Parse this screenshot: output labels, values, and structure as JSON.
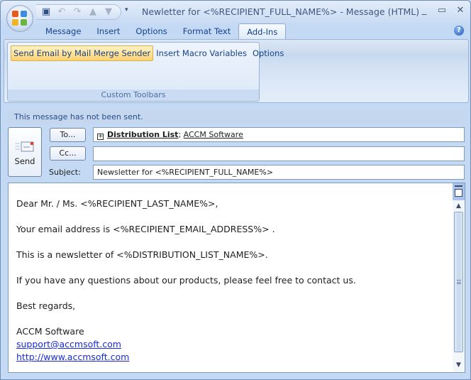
{
  "window": {
    "title": "Newletter for <%RECIPIENT_FULL_NAME%> - Message (HTML)",
    "controls": {
      "minimize": "_",
      "maximize": "▭",
      "close": "✕"
    }
  },
  "quick_access": {
    "icons": [
      "save-icon",
      "undo-icon",
      "redo-icon",
      "previous-item-icon",
      "next-item-icon"
    ],
    "customize_glyph": "▾"
  },
  "tabs": [
    {
      "label": "Message",
      "active": false
    },
    {
      "label": "Insert",
      "active": false
    },
    {
      "label": "Options",
      "active": false
    },
    {
      "label": "Format Text",
      "active": false
    },
    {
      "label": "Add-Ins",
      "active": true
    }
  ],
  "help_glyph": "?",
  "ribbon": {
    "group_label": "Custom Toolbars",
    "buttons": [
      {
        "label": "Send Email by Mail Merge Sender",
        "highlighted": true
      },
      {
        "label": "Insert Macro Variables",
        "highlighted": false
      },
      {
        "label": "Options",
        "highlighted": false
      }
    ]
  },
  "info_bar": "This message has not been sent.",
  "header": {
    "send_label": "Send",
    "to_button": "To...",
    "cc_button": "Cc...",
    "subject_label": "Subject:",
    "to_value": {
      "expand_glyph": "+",
      "distribution_list": "Distribution List",
      "separator": ";",
      "recipient": "ACCM Software"
    },
    "cc_value": "",
    "subject_value": "Newsletter for <%RECIPIENT_FULL_NAME%>"
  },
  "body": {
    "greeting": "Dear Mr. / Ms. <%RECIPIENT_LAST_NAME%>,",
    "line_email": "Your email address is <%RECIPIENT_EMAIL_ADDRESS%> .",
    "line_newsletter": "This is a newsletter of <%DISTRIBUTION_LIST_NAME%>.",
    "line_questions": "If you have any questions about our products, please feel free to contact us.",
    "closing": "Best regards,",
    "signature_name": "ACCM Software",
    "signature_email": "support@accmsoft.com",
    "signature_url": "http://www.accmsoft.com"
  },
  "colors": {
    "accent": "#15428b",
    "link": "#1a2bd8",
    "highlight": "#ffd36e"
  }
}
